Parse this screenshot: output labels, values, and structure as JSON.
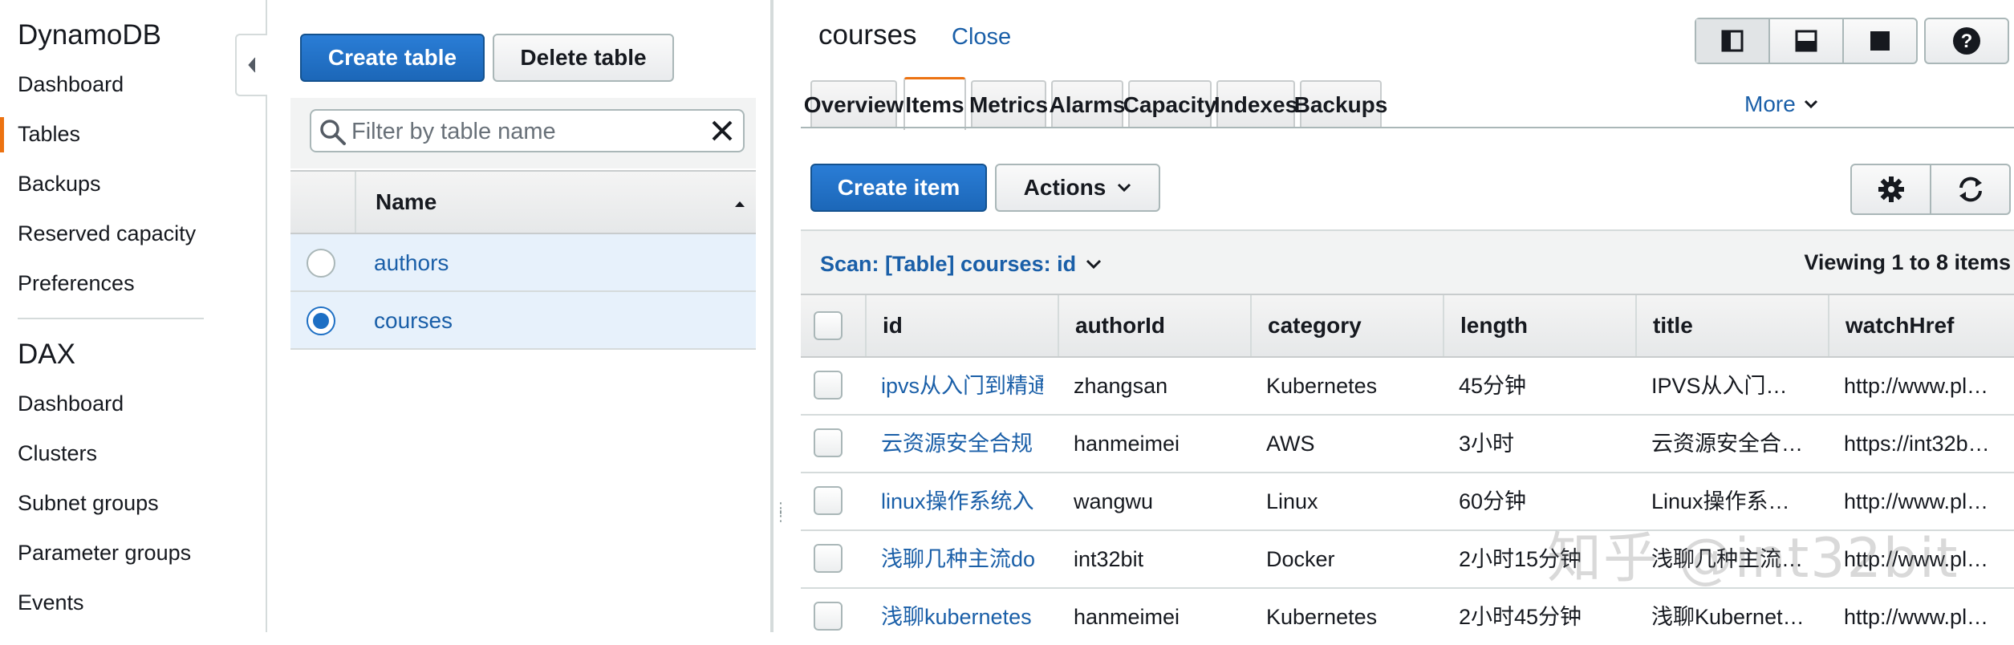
{
  "nav": {
    "section1_title": "DynamoDB",
    "section1_items": [
      "Dashboard",
      "Tables",
      "Backups",
      "Reserved capacity",
      "Preferences"
    ],
    "active_item": "Tables",
    "section2_title": "DAX",
    "section2_items": [
      "Dashboard",
      "Clusters",
      "Subnet groups",
      "Parameter groups",
      "Events"
    ]
  },
  "table_list": {
    "create_label": "Create table",
    "delete_label": "Delete table",
    "filter_placeholder": "Filter by table name",
    "column_header": "Name",
    "rows": [
      {
        "name": "authors",
        "selected": false
      },
      {
        "name": "courses",
        "selected": true
      }
    ]
  },
  "detail": {
    "title": "courses",
    "close_label": "Close",
    "tabs": [
      "Overview",
      "Items",
      "Metrics",
      "Alarms",
      "Capacity",
      "Indexes",
      "Backups"
    ],
    "active_tab": "Items",
    "more_label": "More",
    "create_item_label": "Create item",
    "actions_label": "Actions",
    "scan_label": "Scan: [Table] courses: id",
    "viewing_label": "Viewing 1 to 8 items",
    "columns": [
      "id",
      "authorId",
      "category",
      "length",
      "title",
      "watchHref"
    ],
    "rows": [
      [
        "ipvs从入门到精通",
        "zhangsan",
        "Kubernetes",
        "45分钟",
        "IPVS从入门…",
        "http://www.pl…"
      ],
      [
        "云资源安全合规",
        "hanmeimei",
        "AWS",
        "3小时",
        "云资源安全合…",
        "https://int32b…"
      ],
      [
        "linux操作系统入",
        "wangwu",
        "Linux",
        "60分钟",
        "Linux操作系…",
        "http://www.pl…"
      ],
      [
        "浅聊几种主流do",
        "int32bit",
        "Docker",
        "2小时15分钟",
        "浅聊几种主流…",
        "http://www.pl…"
      ],
      [
        "浅聊kubernetes",
        "hanmeimei",
        "Kubernetes",
        "2小时45分钟",
        "浅聊Kubernet…",
        "http://www.pl…"
      ]
    ]
  },
  "watermark": "知乎 @int32bit",
  "colors": {
    "link": "#1a5fa8",
    "primary_button": "#1d6fc4",
    "active_accent": "#ec7211",
    "selected_row": "#e7f1fb"
  }
}
